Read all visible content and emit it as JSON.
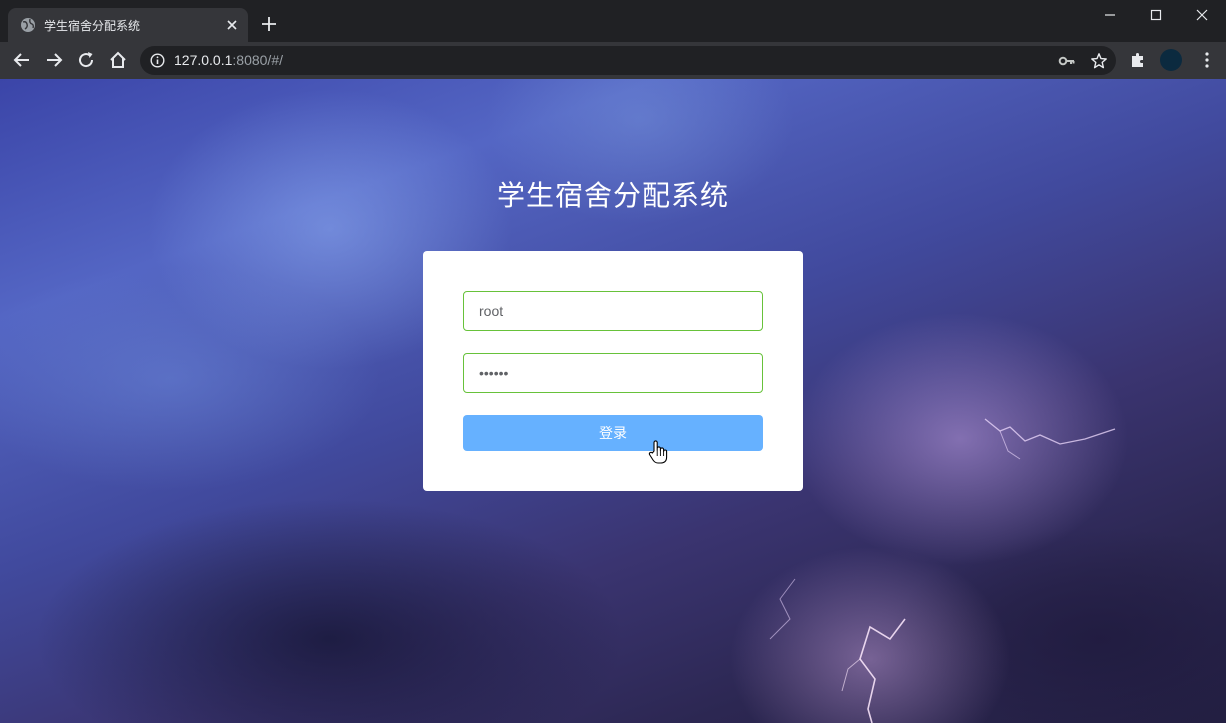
{
  "browser": {
    "tab_title": "学生宿舍分配系统",
    "url_host": "127.0.0.1",
    "url_path": ":8080/#/"
  },
  "page": {
    "title": "学生宿舍分配系统",
    "login_form": {
      "username_value": "root",
      "password_value": "123456",
      "submit_label": "登录"
    }
  },
  "colors": {
    "input_border_success": "#67c23a",
    "button_primary_light": "#66b1ff",
    "card_background": "#ffffff",
    "chrome_dark": "#202124",
    "chrome_toolbar": "#35363a"
  },
  "icons": {
    "tab_favicon": "globe-icon",
    "tab_close": "close-icon",
    "new_tab": "plus-icon",
    "back": "arrow-left-icon",
    "forward": "arrow-right-icon",
    "reload": "reload-icon",
    "home": "home-icon",
    "site_info": "info-icon",
    "password_key": "key-icon",
    "bookmark": "star-icon",
    "extensions": "puzzle-icon",
    "menu": "kebab-menu-icon",
    "cursor": "hand-pointer-icon"
  }
}
